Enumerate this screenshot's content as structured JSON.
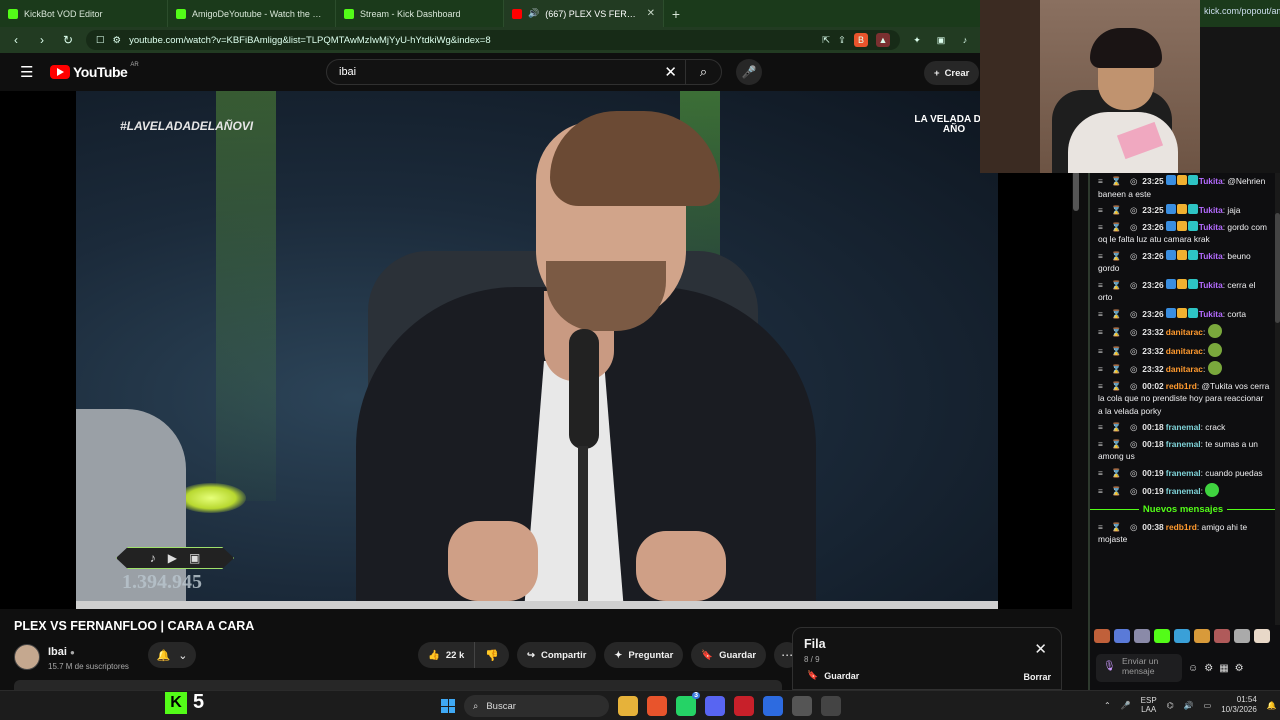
{
  "browser": {
    "tabs": [
      {
        "title": "KickBot VOD Editor",
        "color": "#53fc18",
        "active": false
      },
      {
        "title": "AmigoDeYoutube - Watch the VOD",
        "color": "#53fc18",
        "active": false
      },
      {
        "title": "Stream - Kick Dashboard",
        "color": "#53fc18",
        "active": false
      },
      {
        "title": "(667) PLEX VS FERNANFLOO |",
        "color": "#ff0000",
        "active": true
      }
    ],
    "url": "youtube.com/watch?v=KBFiBAmligg&list=TLPQMTAwMzIwMjYyU-hYtdkiWg&index=8",
    "right_tab": "kick.com/popout/ami..."
  },
  "youtube": {
    "logo": "YouTube",
    "country": "AR",
    "search_value": "ibai",
    "create_label": "Crear"
  },
  "video": {
    "hashtag": "#LAVELADADELAÑOVI",
    "event_logo": "LA VELADA DEL AÑO",
    "counter": "1.394.945",
    "progress": 1.0,
    "title": "PLEX VS FERNANFLOO | CARA A CARA"
  },
  "channel": {
    "name": "Ibai",
    "subscribers": "15.7 M de suscriptores"
  },
  "actions": {
    "likes": "22 k",
    "share": "Compartir",
    "ask": "Preguntar",
    "save": "Guardar"
  },
  "queue": {
    "title": "Fila",
    "position": "8 / 9",
    "save": "Guardar",
    "clear": "Borrar"
  },
  "chat": {
    "messages": [
      {
        "time": "23:25",
        "user": "Tukita",
        "color": "#b46bff",
        "text": "@Nehrien baneen a este",
        "sub": true
      },
      {
        "time": "23:25",
        "user": "Tukita",
        "color": "#b46bff",
        "text": "jaja",
        "sub": true
      },
      {
        "time": "23:26",
        "user": "Tukita",
        "color": "#b46bff",
        "text": "gordo com oq le falta luz atu camara krak",
        "sub": true
      },
      {
        "time": "23:26",
        "user": "Tukita",
        "color": "#b46bff",
        "text": "beuno gordo",
        "sub": true
      },
      {
        "time": "23:26",
        "user": "Tukita",
        "color": "#b46bff",
        "text": "cerra el orto",
        "sub": true
      },
      {
        "time": "23:26",
        "user": "Tukita",
        "color": "#b46bff",
        "text": "corta",
        "sub": true
      },
      {
        "time": "23:32",
        "user": "danitarac",
        "color": "#ff9a2e",
        "text": "",
        "emote": "goblin"
      },
      {
        "time": "23:32",
        "user": "danitarac",
        "color": "#ff9a2e",
        "text": "",
        "emote": "goblin"
      },
      {
        "time": "23:32",
        "user": "danitarac",
        "color": "#ff9a2e",
        "text": "",
        "emote": "goblin"
      },
      {
        "time": "00:02",
        "user": "redb1rd",
        "color": "#ff9a2e",
        "text": "@Tukita vos cerra la cola que no prendiste hoy para reaccionar a la velada porky"
      },
      {
        "time": "00:18",
        "user": "franemal",
        "color": "#7fd3d8",
        "text": "crack"
      },
      {
        "time": "00:18",
        "user": "franemal",
        "color": "#7fd3d8",
        "text": "te sumas a un among us"
      },
      {
        "time": "00:19",
        "user": "franemal",
        "color": "#7fd3d8",
        "text": "cuando puedas"
      },
      {
        "time": "00:19",
        "user": "franemal",
        "color": "#7fd3d8",
        "text": "",
        "emote": "slime"
      }
    ],
    "new_messages_label": "Nuevos mensajes",
    "after_messages": [
      {
        "time": "00:38",
        "user": "redb1rd",
        "color": "#ff9a2e",
        "text": "amigo ahi te mojaste"
      }
    ],
    "input_placeholder": "Enviar un mensaje"
  },
  "taskbar": {
    "kick_count": "5",
    "search_label": "Buscar",
    "discord_badge": "3",
    "language": "ESP",
    "layout": "LAA",
    "time": "01:54",
    "date": "10/3/2026"
  }
}
